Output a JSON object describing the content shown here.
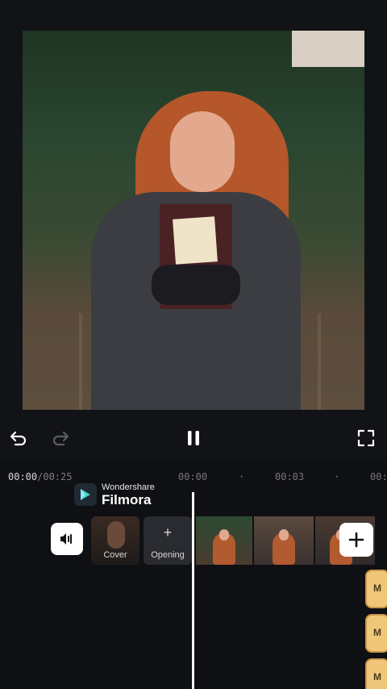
{
  "controls": {
    "undo_icon": "undo-icon",
    "redo_icon": "redo-icon",
    "pause_icon": "pause-icon",
    "fullscreen_icon": "fullscreen-icon"
  },
  "timeline": {
    "current_time": "00:00",
    "total_time": "/00:25",
    "ruler": [
      "00:00",
      "00:03",
      "00:0"
    ],
    "cover_label": "Cover",
    "opening_label": "Opening",
    "opening_plus": "+",
    "music_chip_label": "M"
  },
  "brand": {
    "top": "Wondershare",
    "bottom": "Filmora"
  },
  "colors": {
    "background": "#121317",
    "music_track": "#f0c77a",
    "playhead": "#ffffff"
  }
}
